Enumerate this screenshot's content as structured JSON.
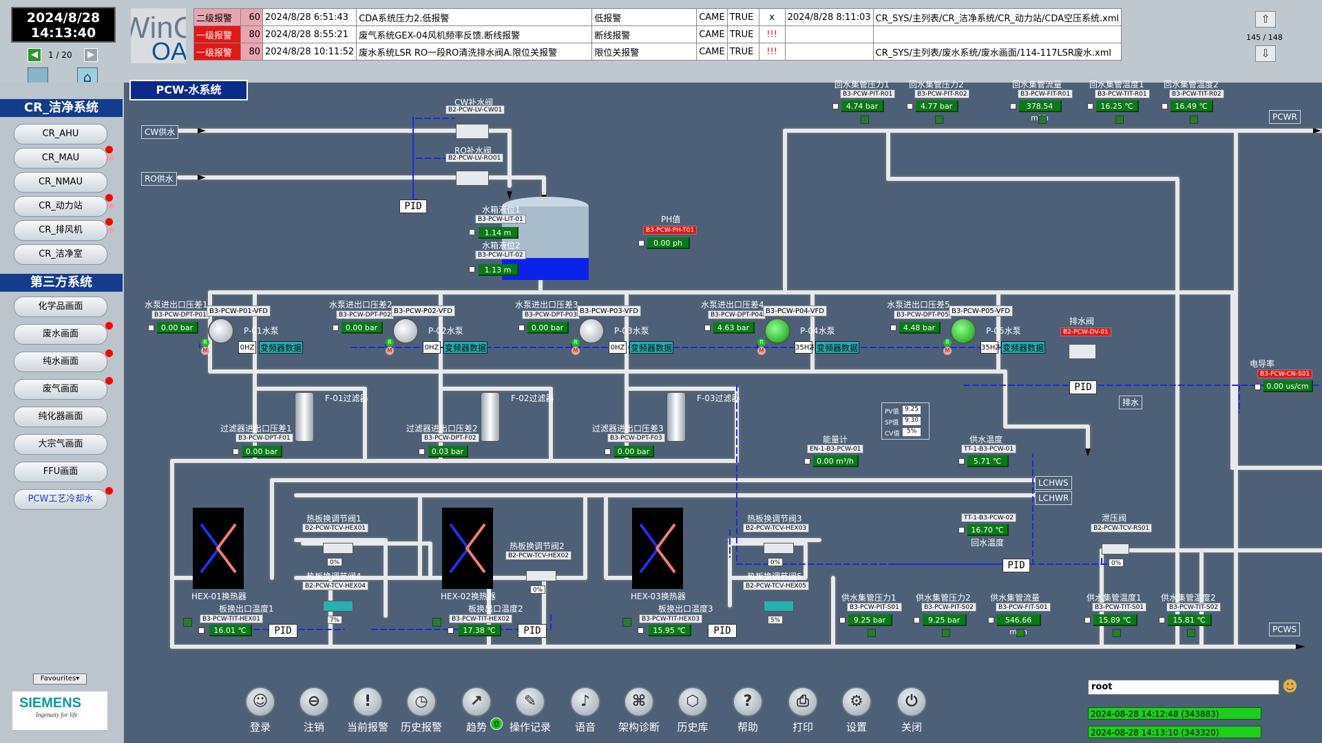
{
  "clock": {
    "date": "2024/8/28",
    "time": "14:13:40"
  },
  "pager": {
    "label": "1 / 20"
  },
  "logo": {
    "text_a": "WinC",
    "text_b": "OA"
  },
  "alarms": [
    {
      "priority": "二级报警",
      "num": "60",
      "time": "2024/8/28 6:51:43",
      "text": "CDA系统压力2.低报警",
      "type": "低报警",
      "state": "CAME",
      "ack": "TRUE",
      "x": "x",
      "time2": "2024/8/28 8:11:03",
      "path": "CR_SYS/主列表/CR_洁净系统/CR_动力站/CDA空压系统.xml"
    },
    {
      "priority": "一级报警",
      "num": "80",
      "time": "2024/8/28 8:55:21",
      "text": "废气系统GEX-04风机频率反馈.断线报警",
      "type": "断线报警",
      "state": "CAME",
      "ack": "TRUE",
      "x": "!!!",
      "time2": "",
      "path": ""
    },
    {
      "priority": "一级报警",
      "num": "80",
      "time": "2024/8/28 10:11:52",
      "text": "废水系统LSR RO一段RO清洗排水阀A.限位关报警",
      "type": "限位关报警",
      "state": "CAME",
      "ack": "TRUE",
      "x": "!!!",
      "time2": "",
      "path": "CR_SYS/主列表/废水系统/废水画面/114-117LSR废水.xml"
    }
  ],
  "alarm_count": "145 / 148",
  "nav": {
    "section1": "CR_洁净系统",
    "items1": [
      "CR_AHU",
      "CR_MAU",
      "CR_NMAU",
      "CR_动力站",
      "CR_排风机",
      "CR_洁净室"
    ],
    "section2": "第三方系统",
    "items2": [
      "化学品画面",
      "废水画面",
      "纯水画面",
      "废气画面",
      "纯化器画面",
      "大宗气画面",
      "FFU画面",
      "PCW工艺冷却水"
    ],
    "favourites": "Favourites▾",
    "siemens": "SIEMENS",
    "tagline": "Ingenuity for life"
  },
  "page_title": "PCW-水系统",
  "sources": {
    "cw": "CW供水",
    "ro": "RO供水",
    "pcwr": "PCWR",
    "pcws": "PCWS",
    "lchws": "LCHWS",
    "lchwr": "LCHWR",
    "drain": "排水"
  },
  "valves": {
    "cw": {
      "name": "CW补水阀",
      "tag": "B2-PCW-LV-CW01"
    },
    "ro": {
      "name": "RO补水阀",
      "tag": "B2-PCW-LV-RO01"
    },
    "drain": {
      "name": "排水阀",
      "tag": "B2-PCW-DV-01"
    }
  },
  "tank": {
    "lvl1_name": "水箱液位1",
    "lvl1_tag": "B3-PCW-LIT-01",
    "lvl1_val": "1.14 m",
    "lvl2_name": "水箱液位2",
    "lvl2_tag": "B3-PCW-LIT-02",
    "lvl2_val": "1.13 m",
    "ph_name": "PH值",
    "ph_tag": "B3-PCW-PH-T01",
    "ph_val": "0.00 ph"
  },
  "return_sensors": [
    {
      "name": "回水集管压力1",
      "tag": "B3-PCW-PIT-R01",
      "val": "4.74 bar"
    },
    {
      "name": "回水集管压力2",
      "tag": "B3-PCW-PIT-R02",
      "val": "4.77 bar"
    },
    {
      "name": "回水集管流量",
      "tag": "B3-PCW-FIT-R01",
      "val": "378.54 m³/h"
    },
    {
      "name": "回水集管温度1",
      "tag": "B3-PCW-TIT-R01",
      "val": "16.25 ℃"
    },
    {
      "name": "回水集管温度2",
      "tag": "B3-PCW-TIT-R02",
      "val": "16.49 ℃"
    }
  ],
  "pumps": [
    {
      "dp_name": "水泵进出口压差1",
      "dp_tag": "B3-PCW-DPT-P01",
      "dp_val": "0.00 bar",
      "vfd_tag": "B3-PCW-P01-VFD",
      "pump": "P-01水泵",
      "hz": "0HZ",
      "vfd_btn": "变频器数据"
    },
    {
      "dp_name": "水泵进出口压差2",
      "dp_tag": "B3-PCW-DPT-P02",
      "dp_val": "0.00 bar",
      "vfd_tag": "B3-PCW-P02-VFD",
      "pump": "P-02水泵",
      "hz": "0HZ",
      "vfd_btn": "变频器数据"
    },
    {
      "dp_name": "水泵进出口压差3",
      "dp_tag": "B3-PCW-DPT-P03",
      "dp_val": "0.00 bar",
      "vfd_tag": "B3-PCW-P03-VFD",
      "pump": "P-03水泵",
      "hz": "0HZ",
      "vfd_btn": "变频器数据"
    },
    {
      "dp_name": "水泵进出口压差4",
      "dp_tag": "B3-PCW-DPT-P04",
      "dp_val": "4.63 bar",
      "vfd_tag": "B3-PCW-P04-VFD",
      "pump": "P-04水泵",
      "hz": "35HZ",
      "vfd_btn": "变频器数据"
    },
    {
      "dp_name": "水泵进出口压差5",
      "dp_tag": "B3-PCW-DPT-P05",
      "dp_val": "4.48 bar",
      "vfd_tag": "B3-PCW-P05-VFD",
      "pump": "P-05水泵",
      "hz": "35HZ",
      "vfd_btn": "变频器数据"
    }
  ],
  "filters": [
    {
      "name": "F-01过滤器",
      "dp_name": "过滤器进出口压差1",
      "dp_tag": "B3-PCW-DPT-F01",
      "dp_val": "0.00 bar"
    },
    {
      "name": "F-02过滤器",
      "dp_name": "过滤器进出口压差2",
      "dp_tag": "B3-PCW-DPT-F02",
      "dp_val": "0.03 bar"
    },
    {
      "name": "F-03过滤器",
      "dp_name": "过滤器进出口压差3",
      "dp_tag": "B3-PCW-DPT-F03",
      "dp_val": "0.00 bar"
    }
  ],
  "pid_panel": {
    "pv_label": "PV值",
    "pv": "9.25",
    "sp_label": "SP值",
    "sp": "9.30",
    "cv_label": "CV值",
    "cv": "5%"
  },
  "energy": {
    "name": "能量计",
    "tag": "EN-1-B3-PCW-01",
    "val": "0.00 m³/h"
  },
  "supply_temp": {
    "name": "供水温度",
    "tag": "TT-1-B3-PCW-01",
    "val": "5.71 ℃"
  },
  "return_temp": {
    "name": "回水温度",
    "tag": "TT-1-B3-PCW-02",
    "val": "16.70 ℃"
  },
  "conductivity": {
    "name": "电导率",
    "tag": "B3-PCW-CN-S01",
    "val": "0.00 us/cm"
  },
  "relief": {
    "name": "泄压阀",
    "tag": "B2-PCW-TCV-RS01",
    "pct": "0%"
  },
  "hex": [
    {
      "name": "HEX-01换热器",
      "tcv_a_name": "热板换调节阀1",
      "tcv_a_tag": "B2-PCW-TCV-HEX01",
      "tcv_a_pct": "0%",
      "tcv_b_name": "热板换调节阀4",
      "tcv_b_tag": "B2-PCW-TCV-HEX04",
      "tcv_b_pct": "7%",
      "temp_name": "板换出口温度1",
      "temp_tag": "B3-PCW-TIT-HEX01",
      "temp_val": "16.01 ℃"
    },
    {
      "name": "HEX-02换热器",
      "tcv_a_name": "热板换调节阀2",
      "tcv_a_tag": "B2-PCW-TCV-HEX02",
      "tcv_a_pct": "0%",
      "temp_name": "板换出口温度2",
      "temp_tag": "B3-PCW-TIT-HEX02",
      "temp_val": "17.38 ℃"
    },
    {
      "name": "HEX-03换热器",
      "tcv_a_name": "热板换调节阀3",
      "tcv_a_tag": "B2-PCW-TCV-HEX03",
      "tcv_a_pct": "0%",
      "tcv_b_name": "热板换调节阀5",
      "tcv_b_tag": "B2-PCW-TCV-HEX05",
      "tcv_b_pct": "5%",
      "temp_name": "板换出口温度3",
      "temp_tag": "B3-PCW-TIT-HEX03",
      "temp_val": "15.95 ℃"
    }
  ],
  "supply_sensors": [
    {
      "name": "供水集管压力1",
      "tag": "B3-PCW-PIT-S01",
      "val": "9.25 bar"
    },
    {
      "name": "供水集管压力2",
      "tag": "B3-PCW-PIT-S02",
      "val": "9.25 bar"
    },
    {
      "name": "供水集管流量",
      "tag": "B3-PCW-FIT-S01",
      "val": "546.66 m³/h"
    },
    {
      "name": "供水集管温度1",
      "tag": "B3-PCW-TIT-S01",
      "val": "15.89 ℃"
    },
    {
      "name": "供水集管温度2",
      "tag": "B3-PCW-TIT-S02",
      "val": "15.81 ℃"
    }
  ],
  "pid_label": "PID",
  "toolbar": [
    "登录",
    "注销",
    "当前报警",
    "历史报警",
    "趋势",
    "操作记录",
    "语音",
    "架构诊断",
    "历史库",
    "帮助",
    "打印",
    "设置",
    "关闭"
  ],
  "trend_badge": "0",
  "user": {
    "name": "root",
    "log1": "2024-08-28 14:12:48 (343883)",
    "log2": "2024-08-28 14:13:10 (343320)"
  },
  "colors": {
    "pipe": "#d8dde2",
    "alarm_red": "#e01818",
    "value_green": "#0a7a18",
    "nav_blue": "#143c8c",
    "control_line": "#1a2adc"
  }
}
